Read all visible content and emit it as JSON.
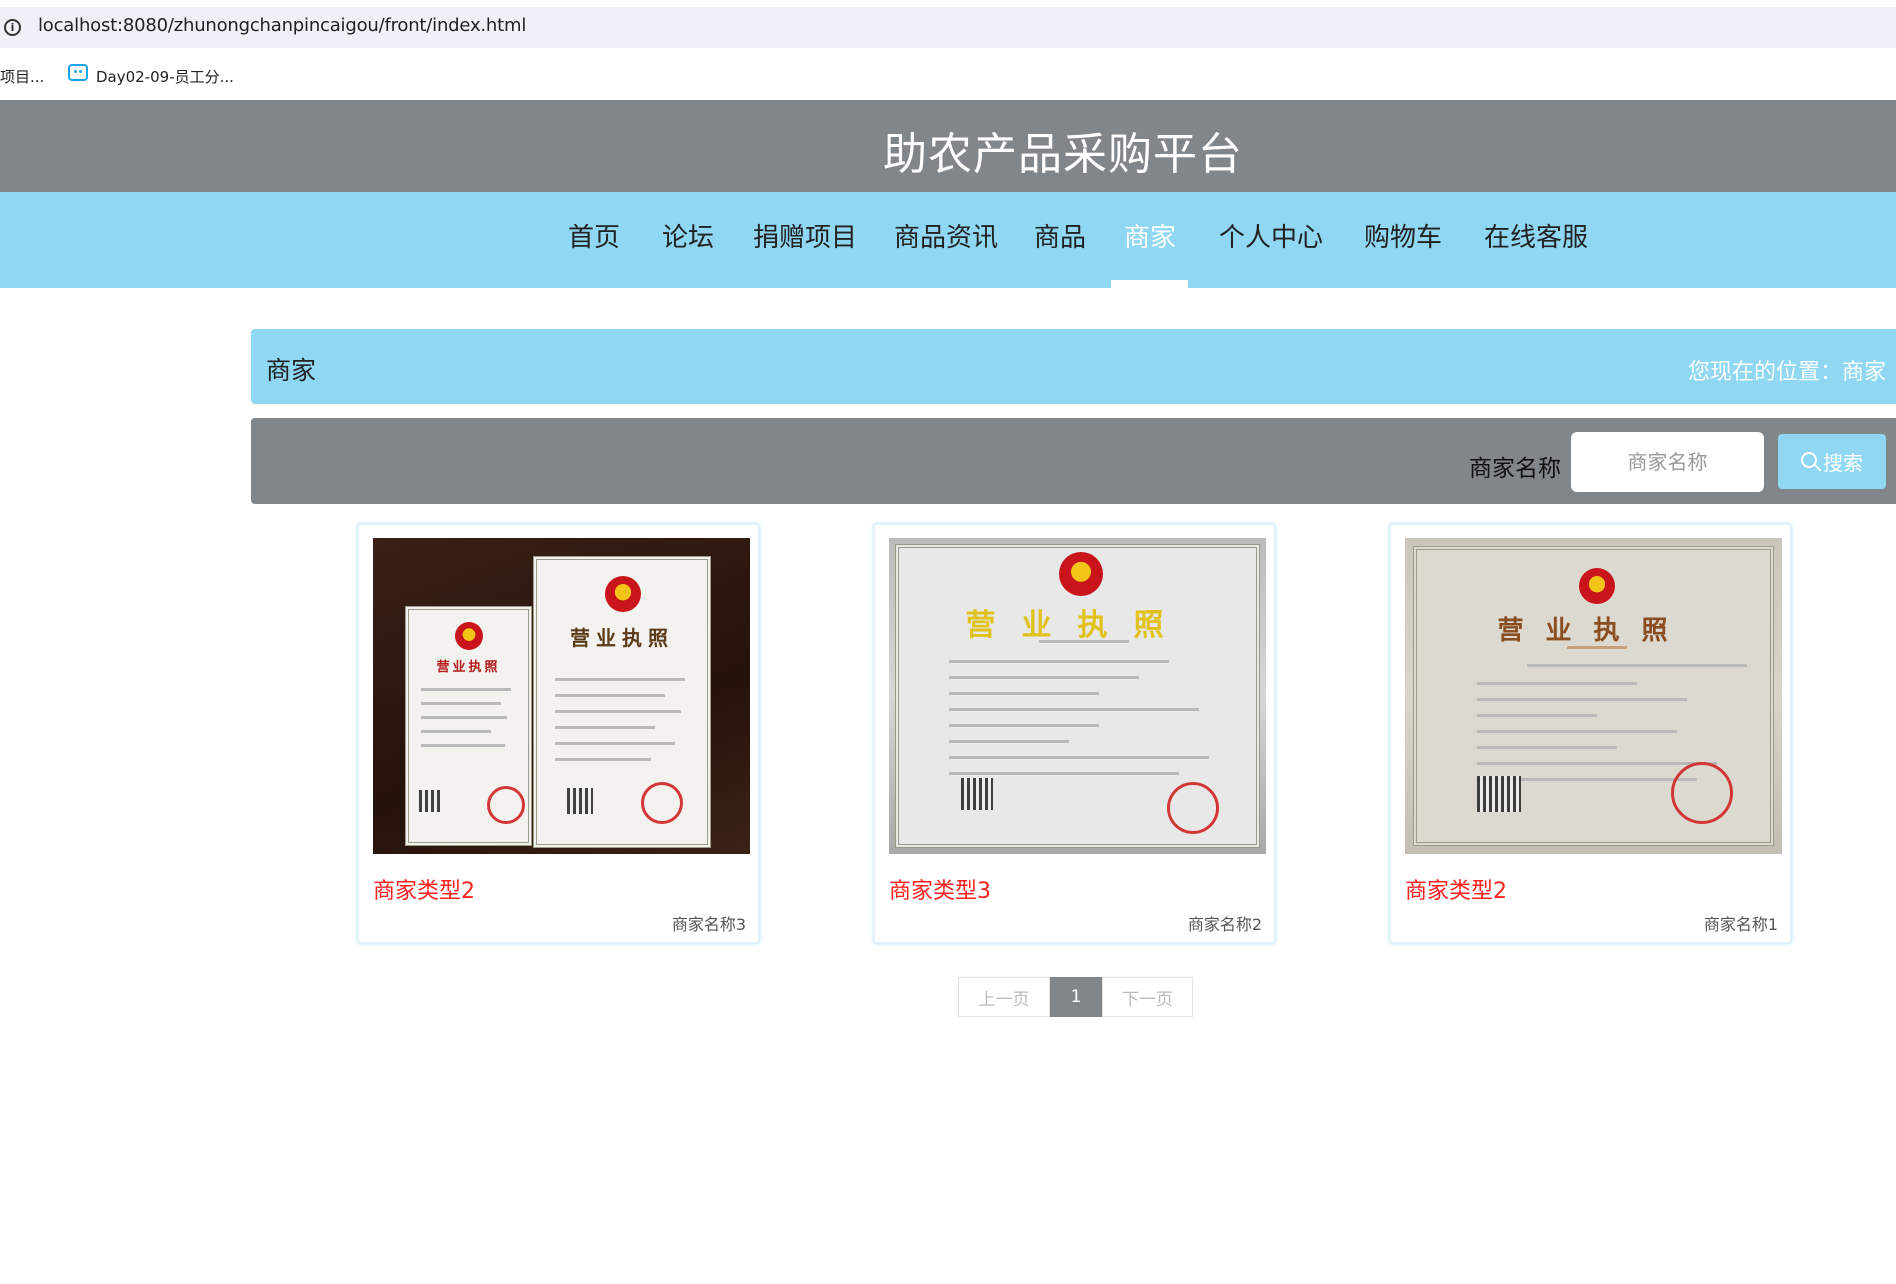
{
  "browser": {
    "url": "localhost:8080/zhunongchanpincaigou/front/index.html",
    "bookmarks": [
      {
        "label": "项目..."
      },
      {
        "label": "Day02-09-员工分..."
      }
    ]
  },
  "site": {
    "title": "助农产品采购平台",
    "nav": [
      {
        "label": "首页"
      },
      {
        "label": "论坛"
      },
      {
        "label": "捐赠项目"
      },
      {
        "label": "商品资讯"
      },
      {
        "label": "商品"
      },
      {
        "label": "商家",
        "active": true
      },
      {
        "label": "个人中心"
      },
      {
        "label": "购物车"
      },
      {
        "label": "在线客服"
      }
    ]
  },
  "breadcrumb": {
    "title": "商家",
    "location": "您现在的位置：商家"
  },
  "search": {
    "label": "商家名称",
    "placeholder": "商家名称",
    "button_label": "搜索"
  },
  "cards": [
    {
      "type": "商家类型2",
      "name": "商家名称3",
      "image": "business-license-photo"
    },
    {
      "type": "商家类型3",
      "name": "商家名称2",
      "image": "business-license-photo"
    },
    {
      "type": "商家类型2",
      "name": "商家名称1",
      "image": "business-license-photo"
    }
  ],
  "license_text": {
    "heading": "营业执照"
  },
  "pagination": {
    "prev_label": "上一页",
    "current_page": "1",
    "next_label": "下一页"
  },
  "colors": {
    "header_gray": "#808689",
    "nav_blue": "#8fd7f3",
    "card_type_red": "#ff1e1e"
  }
}
